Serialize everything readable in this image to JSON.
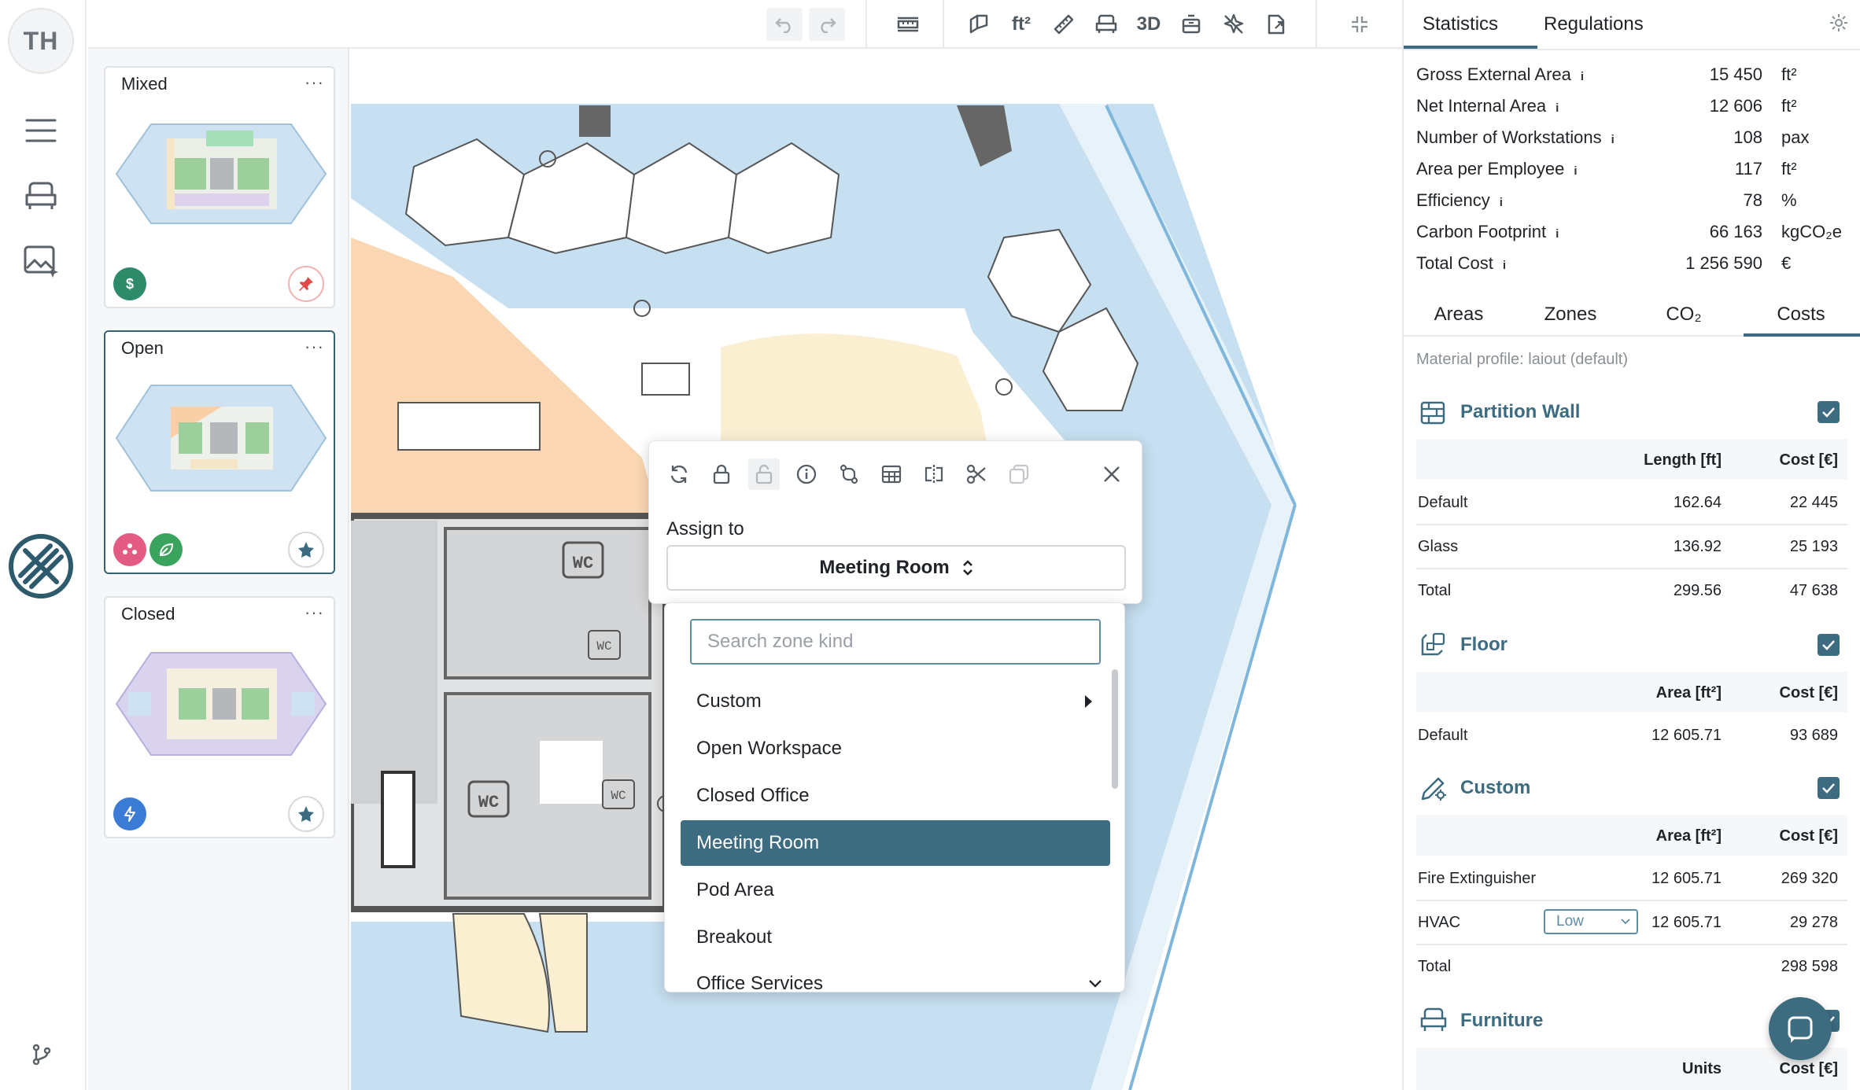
{
  "user": {
    "initials": "TH"
  },
  "rail": {
    "items": [
      "menu",
      "furniture",
      "image-ai"
    ]
  },
  "variants": [
    {
      "title": "Mixed",
      "more": "···"
    },
    {
      "title": "Open",
      "more": "···"
    },
    {
      "title": "Closed",
      "more": "···"
    }
  ],
  "toolbar": {
    "area_unit": "ft²",
    "view3d": "3D"
  },
  "canvas": {
    "wc": "WC"
  },
  "popup": {
    "assign_label": "Assign to",
    "selected_zone": "Meeting Room"
  },
  "dropdown": {
    "placeholder": "Search zone kind",
    "items": [
      "Custom",
      "Open Workspace",
      "Closed Office",
      "Meeting Room",
      "Pod Area",
      "Breakout",
      "Office Services"
    ]
  },
  "right": {
    "tabs": [
      "Statistics",
      "Regulations"
    ],
    "stats": [
      {
        "label": "Gross External Area",
        "value": "15 450",
        "unit": "ft²"
      },
      {
        "label": "Net Internal Area",
        "value": "12 606",
        "unit": "ft²"
      },
      {
        "label": "Number of Workstations",
        "value": "108",
        "unit": "pax"
      },
      {
        "label": "Area per Employee",
        "value": "117",
        "unit": "ft²"
      },
      {
        "label": "Efficiency",
        "value": "78",
        "unit": "%"
      },
      {
        "label": "Carbon Footprint",
        "value": "66 163",
        "unit": "kgCO₂e"
      },
      {
        "label": "Total Cost",
        "value": "1 256 590",
        "unit": "€"
      }
    ],
    "info": "i",
    "subtabs": [
      "Areas",
      "Zones",
      "CO₂",
      "Costs"
    ],
    "material_profile": "Material profile: laiout (default)",
    "sections": {
      "partition": {
        "title": "Partition Wall",
        "headers": [
          "Length [ft]",
          "Cost [€]"
        ],
        "rows": [
          [
            "Default",
            "162.64",
            "22 445"
          ],
          [
            "Glass",
            "136.92",
            "25 193"
          ],
          [
            "Total",
            "299.56",
            "47 638"
          ]
        ]
      },
      "floor": {
        "title": "Floor",
        "headers": [
          "Area [ft²]",
          "Cost [€]"
        ],
        "rows": [
          [
            "Default",
            "12 605.71",
            "93 689"
          ]
        ]
      },
      "custom": {
        "title": "Custom",
        "headers": [
          "Area [ft²]",
          "Cost [€]"
        ],
        "rows": [
          [
            "Fire Extinguisher",
            "12 605.71",
            "269 320"
          ],
          [
            "HVAC",
            "12 605.71",
            "29 278"
          ],
          [
            "Total",
            "",
            "298 598"
          ]
        ],
        "hvac_level": "Low"
      },
      "furniture": {
        "title": "Furniture",
        "headers": [
          "Units",
          "Cost [€]"
        ]
      }
    }
  }
}
